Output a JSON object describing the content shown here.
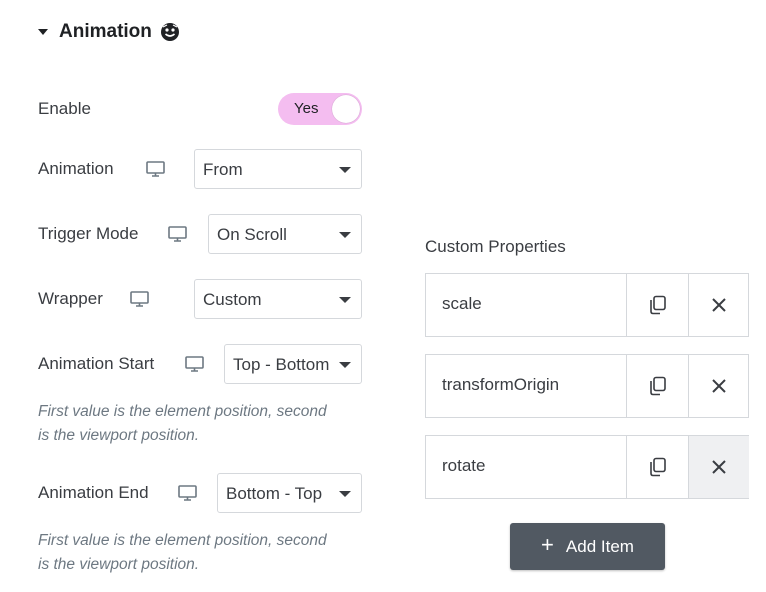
{
  "section": {
    "title": "Animation",
    "badge_icon": "pro-badge-icon"
  },
  "enable": {
    "label": "Enable",
    "toggle_text": "Yes",
    "toggle_on": true,
    "toggle_color": "#f4bdf0"
  },
  "fields": {
    "animation": {
      "label": "Animation",
      "value": "From"
    },
    "trigger_mode": {
      "label": "Trigger Mode",
      "value": "On Scroll"
    },
    "wrapper": {
      "label": "Wrapper",
      "value": "Custom"
    },
    "animation_start": {
      "label": "Animation Start",
      "value": "Top - Bottom"
    },
    "animation_end": {
      "label": "Animation End",
      "value": "Bottom - Top"
    }
  },
  "help_text": {
    "start": [
      "First value is the element position, second",
      "is the viewport position."
    ],
    "end": [
      "First value is the element position, second",
      "is the viewport position."
    ]
  },
  "custom_properties": {
    "label": "Custom Properties",
    "items": [
      {
        "name": "scale"
      },
      {
        "name": "transformOrigin"
      },
      {
        "name": "rotate"
      }
    ],
    "add_label": "Add Item",
    "add_button_color": "#515962"
  }
}
